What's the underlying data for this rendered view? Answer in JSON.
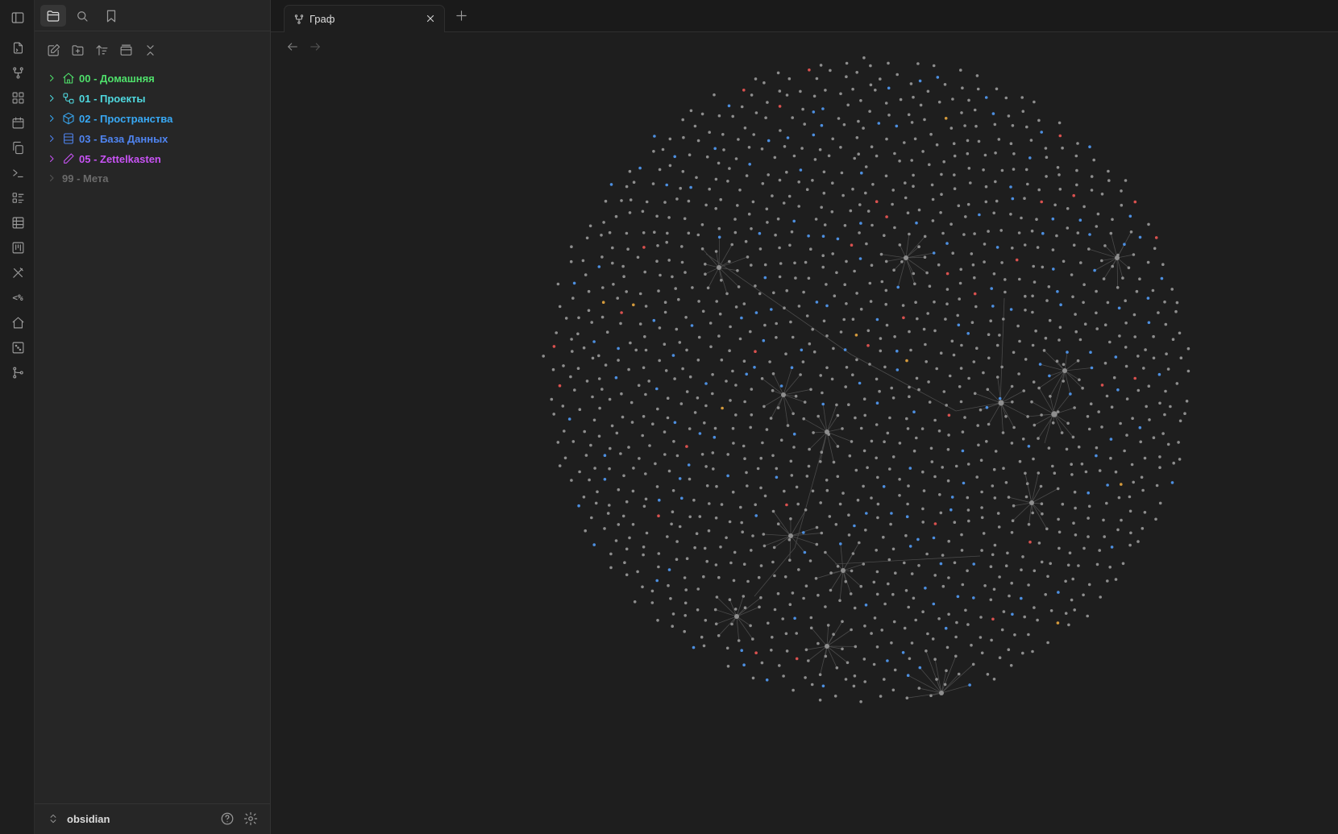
{
  "tabs": [
    {
      "title": "Граф"
    }
  ],
  "sidebar": {
    "folders": [
      {
        "label": "00 - Домашняя",
        "color": "#4fe06b",
        "icon": "home-icon"
      },
      {
        "label": "01 - Проекты",
        "color": "#4fd8df",
        "icon": "workflow-icon"
      },
      {
        "label": "02 - Пространства",
        "color": "#38a9f5",
        "icon": "box-icon"
      },
      {
        "label": "03 - База Данных",
        "color": "#4f84f0",
        "icon": "table-icon"
      },
      {
        "label": "05 - Zettelkasten",
        "color": "#c853f5",
        "icon": "pencil-icon"
      },
      {
        "label": "99 - Мета",
        "color": "#6b6b6b",
        "icon": ""
      }
    ],
    "vault_name": "obsidian"
  },
  "graph": {
    "node_colors": {
      "default": "#8e8e8e",
      "blue": "#4d8fe0",
      "red": "#d9514f",
      "orange": "#d49a3c"
    },
    "link_color": "#4a4a4a"
  }
}
